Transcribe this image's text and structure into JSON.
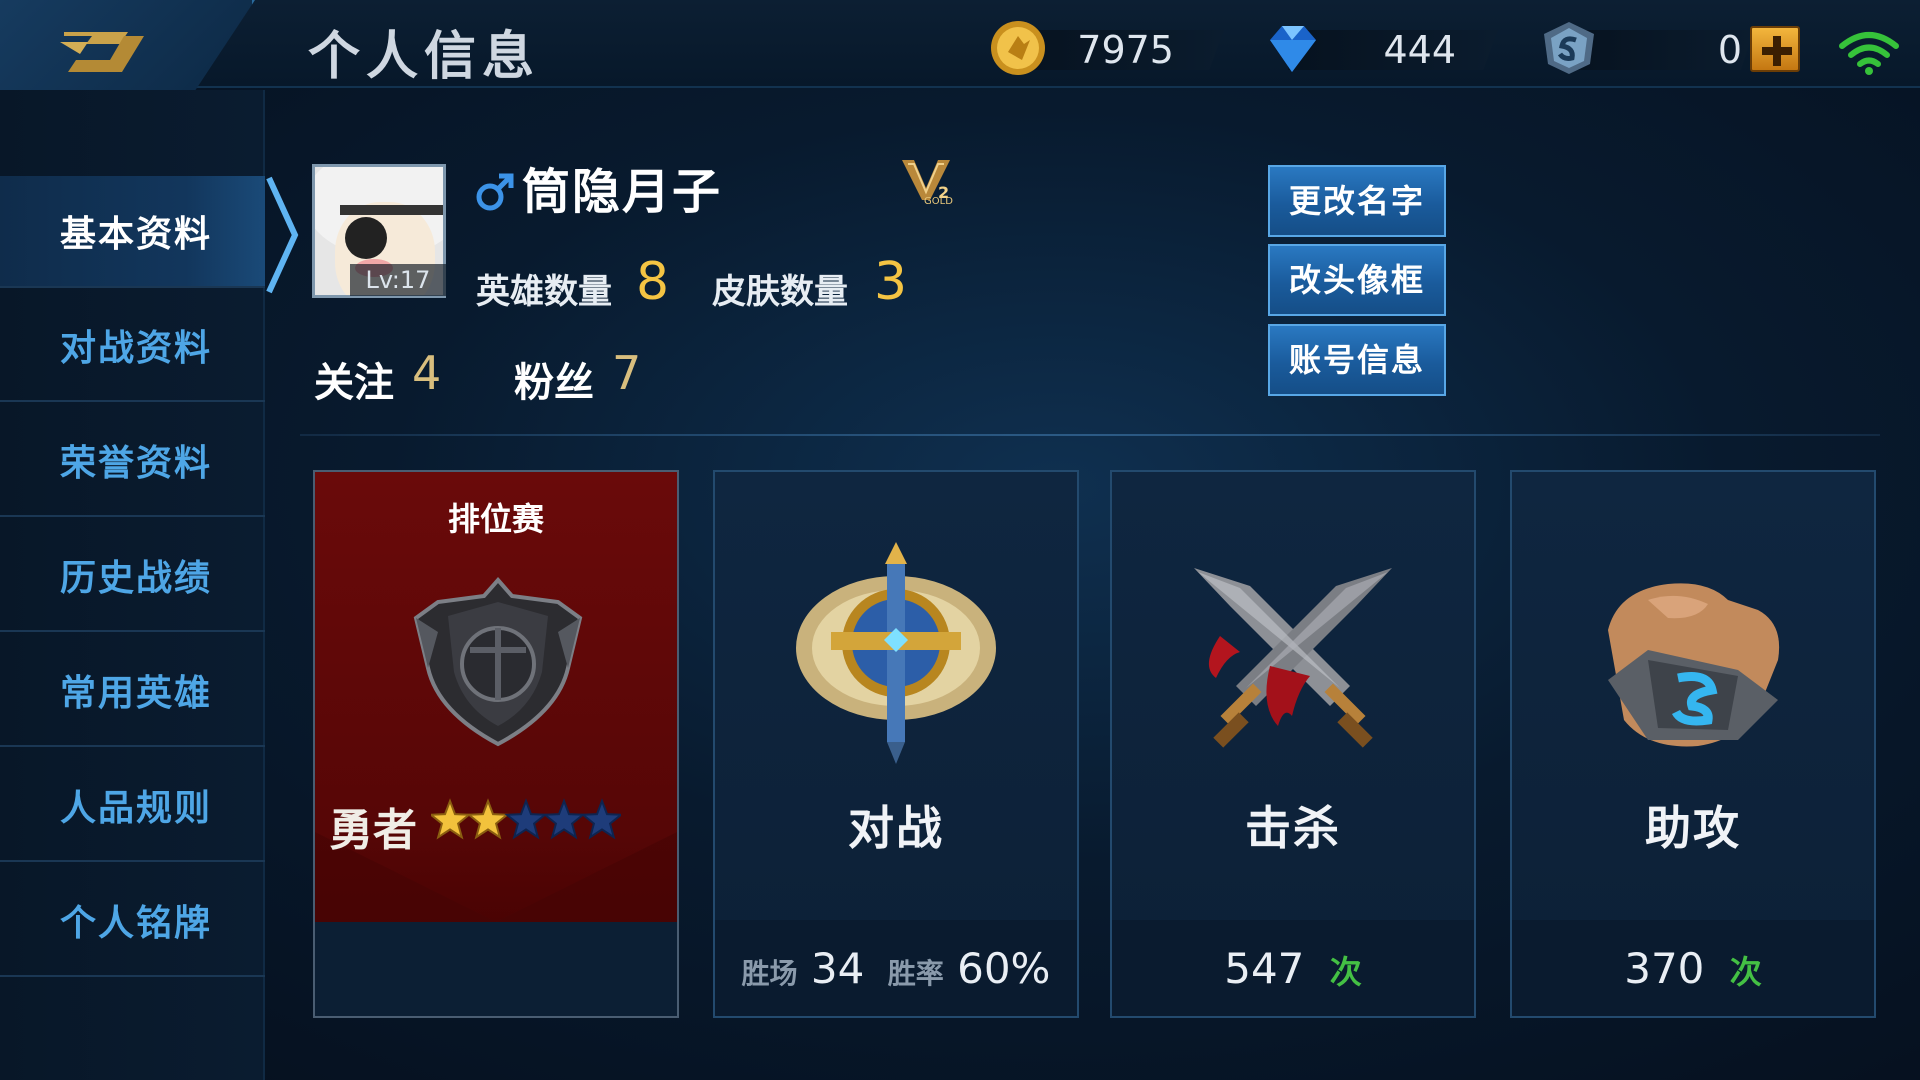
{
  "header": {
    "title": "个人信息",
    "back_icon": "back-arrow-icon",
    "currencies": [
      {
        "name": "gold",
        "icon": "gold-coin-icon",
        "value": "7975"
      },
      {
        "name": "diamond",
        "icon": "diamond-icon",
        "value": "444"
      },
      {
        "name": "voucher",
        "icon": "voucher-icon",
        "value": "0"
      }
    ],
    "plus_icon": "plus-icon",
    "wifi_icon": "wifi-icon"
  },
  "sidebar": {
    "items": [
      {
        "label": "基本资料",
        "active": true
      },
      {
        "label": "对战资料",
        "active": false
      },
      {
        "label": "荣誉资料",
        "active": false
      },
      {
        "label": "历史战绩",
        "active": false
      },
      {
        "label": "常用英雄",
        "active": false
      },
      {
        "label": "人品规则",
        "active": false
      },
      {
        "label": "个人铭牌",
        "active": false
      }
    ]
  },
  "profile": {
    "level": "Lv:17",
    "gender_icon": "male-symbol-icon",
    "name": "筒隐月子",
    "rank_badge_icon": "gold-rank-badge-icon",
    "hero_label": "英雄数量",
    "hero_count": "8",
    "skin_label": "皮肤数量",
    "skin_count": "3",
    "follow_label": "关注",
    "follow_count": "4",
    "fans_label": "粉丝",
    "fans_count": "7"
  },
  "actions": {
    "rename": "更改名字",
    "avatar_frame": "改头像框",
    "account_info": "账号信息"
  },
  "cards": {
    "ranked": {
      "title": "排位赛",
      "icon": "rank-shield-icon",
      "tier": "勇者",
      "stars_total": 5,
      "stars_filled": 2
    },
    "battle": {
      "icon": "sword-emblem-icon",
      "label": "对战",
      "wins_label": "胜场",
      "wins": "34",
      "rate_label": "胜率",
      "rate": "60%"
    },
    "kills": {
      "icon": "crossed-swords-icon",
      "label": "击杀",
      "value": "547",
      "unit": "次"
    },
    "assists": {
      "icon": "handshake-icon",
      "label": "助攻",
      "value": "370",
      "unit": "次"
    }
  },
  "colors": {
    "accent_blue": "#4ea6e6",
    "gold_number": "#f4c443",
    "ranked_red": "#5c0808",
    "green_unit": "#44c044"
  }
}
